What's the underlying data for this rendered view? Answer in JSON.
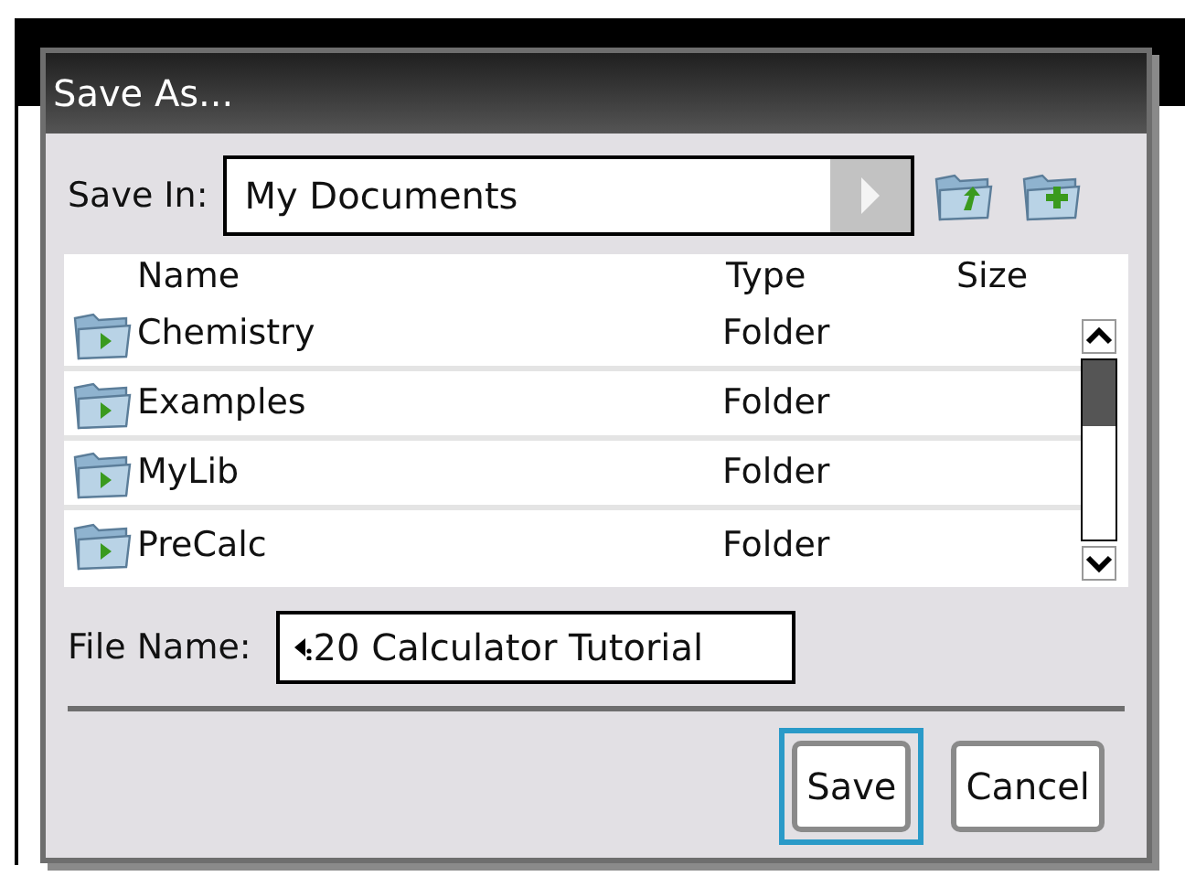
{
  "dialog": {
    "title": "Save As..."
  },
  "save_in": {
    "label": "Save In:",
    "value": "My Documents"
  },
  "table": {
    "columns": [
      "Name",
      "Type",
      "Size"
    ],
    "rows": [
      {
        "name": "Chemistry",
        "type": "Folder"
      },
      {
        "name": "Examples",
        "type": "Folder"
      },
      {
        "name": "MyLib",
        "type": "Folder"
      },
      {
        "name": "PreCalc",
        "type": "Folder"
      }
    ]
  },
  "file_name": {
    "label": "File Name:",
    "value": "20 Calculator Tutorial"
  },
  "buttons": [
    {
      "label": "Save",
      "focused": true
    },
    {
      "label": "Cancel",
      "focused": false
    }
  ]
}
